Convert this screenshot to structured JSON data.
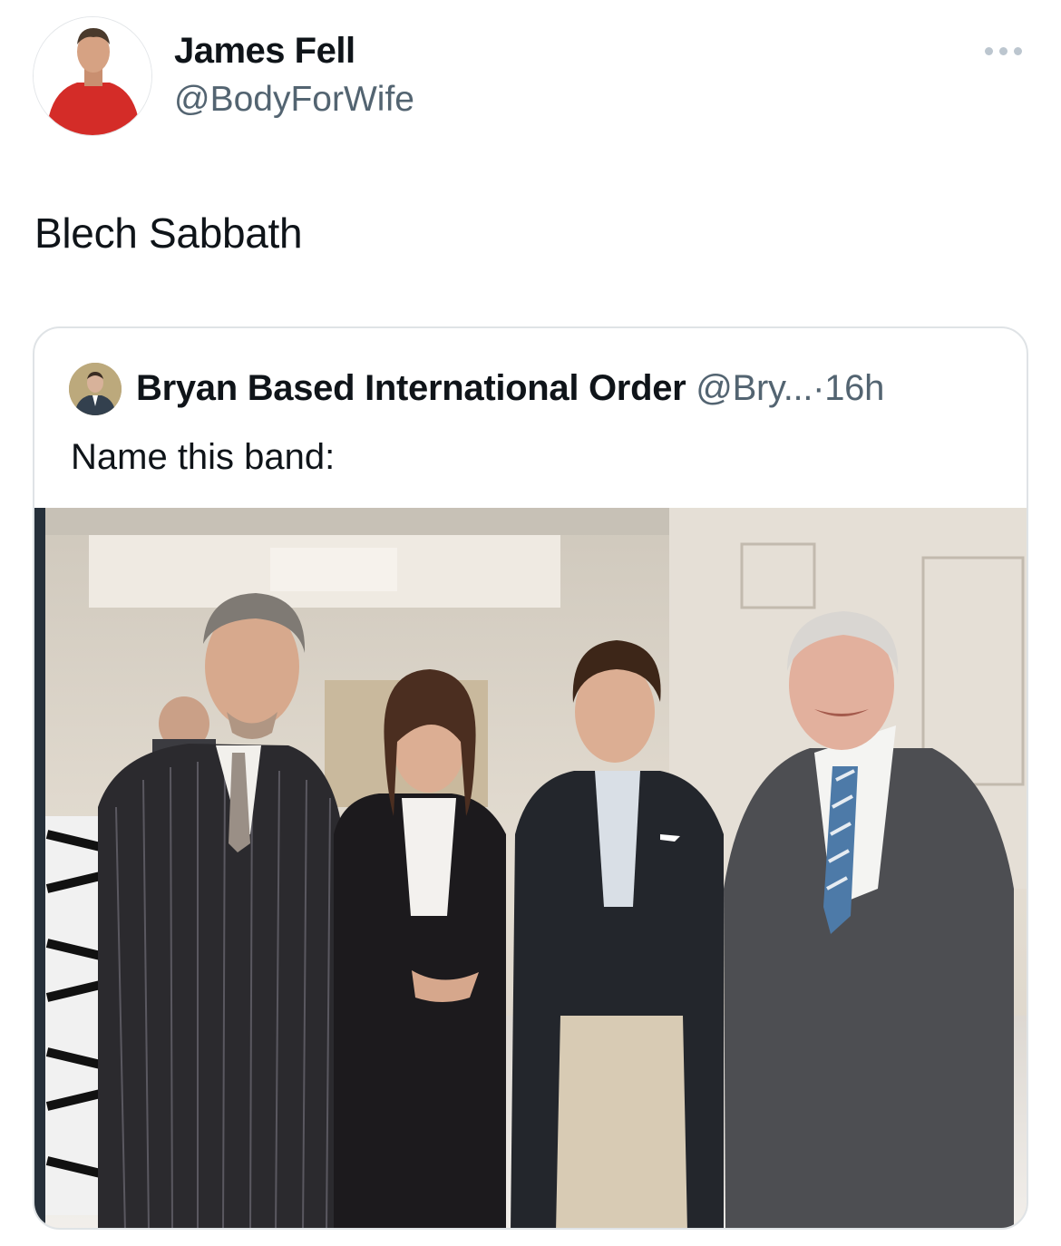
{
  "tweet": {
    "author_name": "James Fell",
    "author_handle": "@BodyForWife",
    "text": "Blech Sabbath",
    "avatar_icon": "user-avatar-red-shirt"
  },
  "quote": {
    "author_name": "Bryan Based International Order",
    "author_handle": "@Bry...",
    "separator": "·",
    "age": "16h",
    "text": "Name this band:",
    "avatar_icon": "user-avatar-suit",
    "media": "photo-four-people-standing-indoors"
  },
  "colors": {
    "text_primary": "#0f1419",
    "text_secondary": "#536471",
    "border": "#dfe3e6"
  }
}
